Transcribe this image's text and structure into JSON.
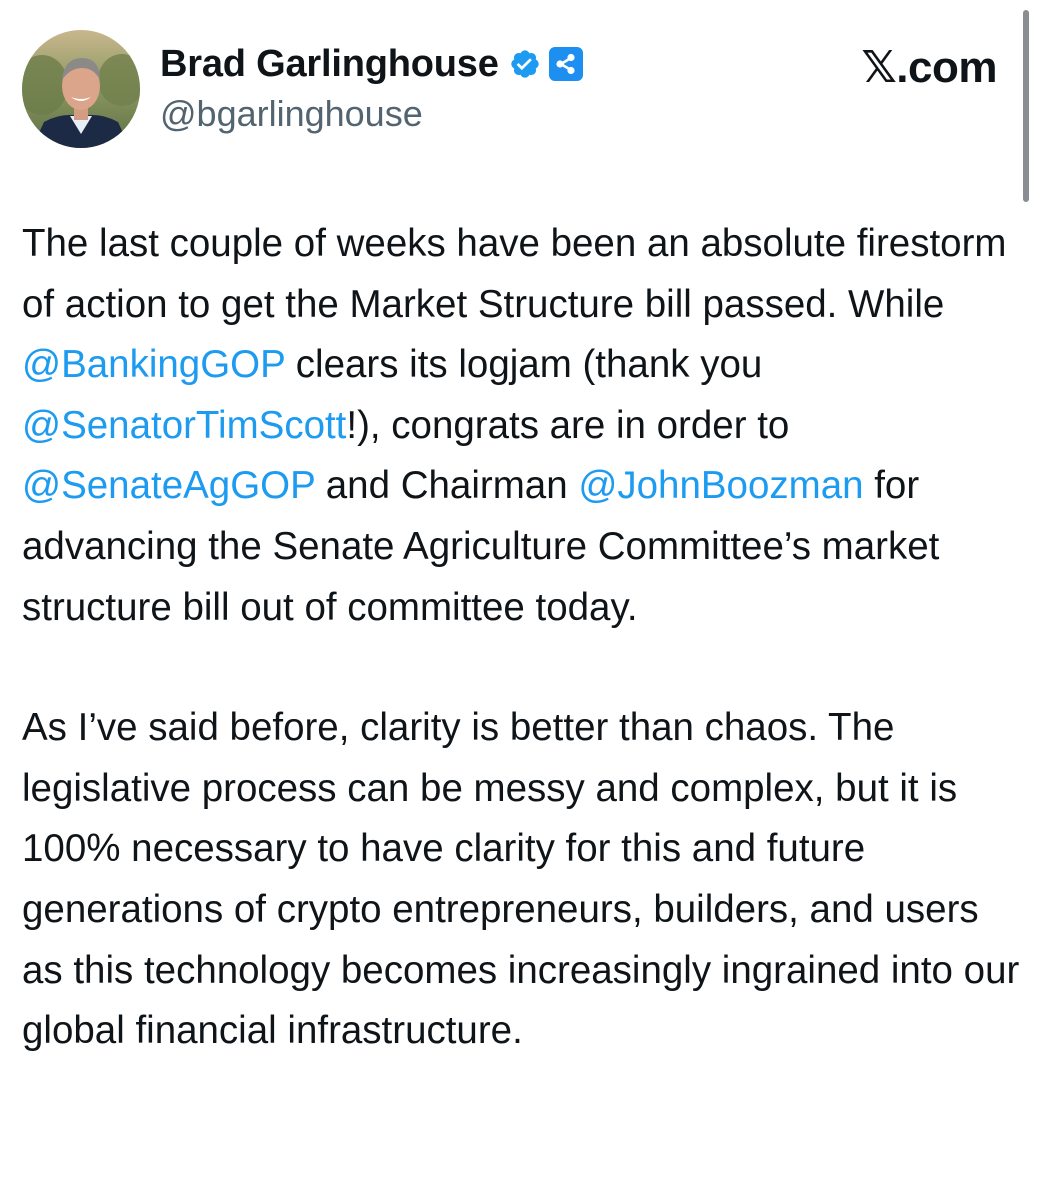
{
  "author": {
    "name": "Brad Garlinghouse",
    "handle": "@bgarlinghouse",
    "verified_icon": "verified-badge-icon",
    "affiliate_icon": "ripple-logo-icon"
  },
  "brand": "𝕏.com",
  "colors": {
    "accent": "#1d9bf0",
    "text": "#0f1419",
    "secondary_text": "#536471"
  },
  "tweet": {
    "p1": {
      "s1": "The last couple of weeks have been an absolute firestorm of action to get the Market Structure bill passed. While ",
      "m1": "@BankingGOP",
      "s2": " clears its logjam (thank you ",
      "m2": "@SenatorTimScott",
      "s3": "!), congrats are in order to ",
      "m3": "@SenateAgGOP",
      "s4": " and Chairman ",
      "m4": "@JohnBoozman",
      "s5": " for advancing the Senate Agriculture Committee’s market structure bill out of committee today."
    },
    "p2": "As I’ve said before, clarity is better than chaos. The legislative process can be messy and complex, but it is 100% necessary to have clarity for this and future generations of crypto entrepreneurs, builders, and users as this technology becomes increasingly ingrained into our global financial infrastructure."
  }
}
